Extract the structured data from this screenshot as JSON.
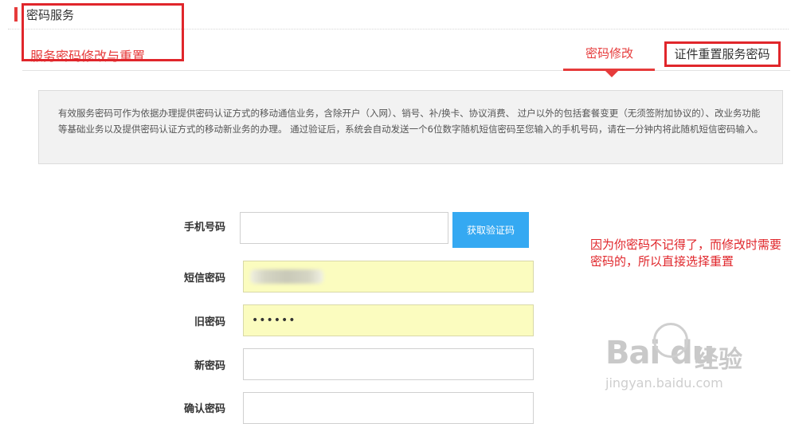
{
  "header": {
    "section_title": "密码服务",
    "page_subtitle": "服务密码修改与重置"
  },
  "tabs": [
    {
      "label": "密码修改",
      "active": true
    },
    {
      "label": "证件重置服务密码",
      "active": false
    }
  ],
  "notice": {
    "text": "有效服务密码可作为依据办理提供密码认证方式的移动通信业务，含除开户（入网）、销号、补/换卡、协议消费、 过户以外的包括套餐变更（无须签附加协议的）、改业务功能等基础业务以及提供密码认证方式的移动新业务的办理。 通过验证后，系统会自动发送一个6位数字随机短信密码至您输入的手机号码，请在一分钟内将此随机短信密码输入。"
  },
  "form": {
    "phone_label": "手机号码",
    "phone_value": "",
    "get_code_button": "获取验证码",
    "sms_label": "短信密码",
    "old_pwd_label": "旧密码",
    "old_pwd_value": "••••••",
    "new_pwd_label": "新密码",
    "new_pwd_value": "",
    "confirm_label": "确认密码",
    "confirm_value": ""
  },
  "annotation": {
    "note": "因为你密码不记得了，而修改时需要密码的，所以直接选择重置"
  },
  "watermark": {
    "logo": "Bai du",
    "brand": "经验",
    "url": "jingyan.baidu.com"
  },
  "colors": {
    "accent": "#e63b3b",
    "annotation_red": "#e0262b",
    "button_blue": "#35a9f2",
    "autofill_yellow": "#fbfcbf"
  }
}
